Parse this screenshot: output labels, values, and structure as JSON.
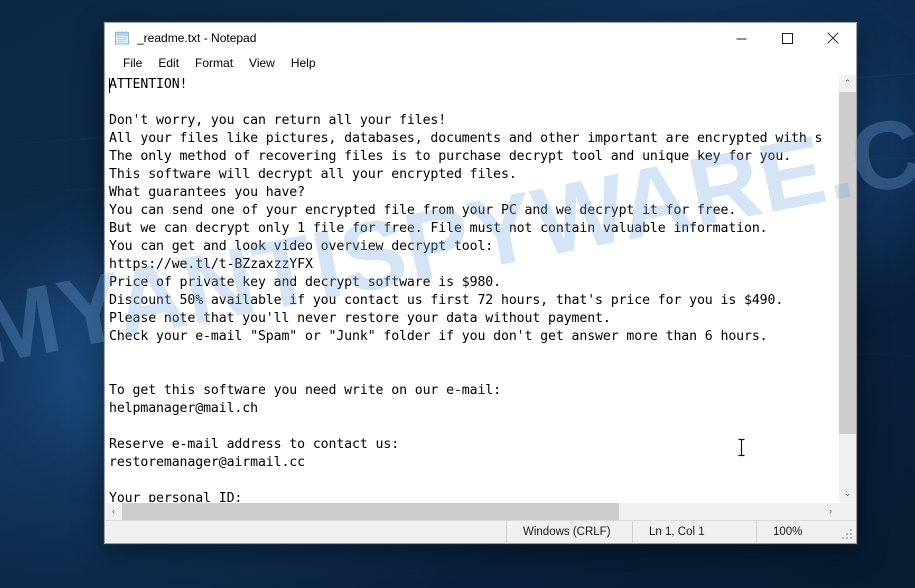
{
  "desktop": {
    "background_color": "#0a2340",
    "watermark_text": "MYANTISPYWARE.COM"
  },
  "window": {
    "title": "_readme.txt - Notepad",
    "icon": "notepad-icon",
    "controls": {
      "minimize_label": "Minimize",
      "maximize_label": "Maximize",
      "close_label": "Close"
    },
    "menu": [
      {
        "label": "File"
      },
      {
        "label": "Edit"
      },
      {
        "label": "Format"
      },
      {
        "label": "View"
      },
      {
        "label": "Help"
      }
    ]
  },
  "editor": {
    "content": "ATTENTION!\n\nDon't worry, you can return all your files!\nAll your files like pictures, databases, documents and other important are encrypted with s\nThe only method of recovering files is to purchase decrypt tool and unique key for you.\nThis software will decrypt all your encrypted files.\nWhat guarantees you have?\nYou can send one of your encrypted file from your PC and we decrypt it for free.\nBut we can decrypt only 1 file for free. File must not contain valuable information.\nYou can get and look video overview decrypt tool:\nhttps://we.tl/t-BZzaxzzYFX\nPrice of private key and decrypt software is $980.\nDiscount 50% available if you contact us first 72 hours, that's price for you is $490.\nPlease note that you'll never restore your data without payment.\nCheck your e-mail \"Spam\" or \"Junk\" folder if you don't get answer more than 6 hours.\n\n\nTo get this software you need write on our e-mail:\nhelpmanager@mail.ch\n\nReserve e-mail address to contact us:\nrestoremanager@airmail.cc\n\nYour personal ID:",
    "lines": [
      "ATTENTION!",
      "",
      "Don't worry, you can return all your files!",
      "All your files like pictures, databases, documents and other important are encrypted with s",
      "The only method of recovering files is to purchase decrypt tool and unique key for you.",
      "This software will decrypt all your encrypted files.",
      "What guarantees you have?",
      "You can send one of your encrypted file from your PC and we decrypt it for free.",
      "But we can decrypt only 1 file for free. File must not contain valuable information.",
      "You can get and look video overview decrypt tool:",
      "https://we.tl/t-BZzaxzzYFX",
      "Price of private key and decrypt software is $980.",
      "Discount 50% available if you contact us first 72 hours, that's price for you is $490.",
      "Please note that you'll never restore your data without payment.",
      "Check your e-mail \"Spam\" or \"Junk\" folder if you don't get answer more than 6 hours.",
      "",
      "",
      "To get this software you need write on our e-mail:",
      "helpmanager@mail.ch",
      "",
      "Reserve e-mail address to contact us:",
      "restoremanager@airmail.cc",
      "",
      "Your personal ID:"
    ],
    "ransom_details": {
      "video_url": "https://we.tl/t-BZzaxzzYFX",
      "price": "$980",
      "discount_price": "$490",
      "discount_percent": "50%",
      "discount_window": "72 hours",
      "response_time": "6 hours",
      "free_decrypt_files": "1 file",
      "primary_email": "helpmanager@mail.ch",
      "reserve_email": "restoremanager@airmail.cc"
    }
  },
  "scrollbars": {
    "vertical": {
      "up_arrow": "⌃",
      "down_arrow": "⌄",
      "thumb_percent": 87
    },
    "horizontal": {
      "left_arrow": "‹",
      "right_arrow": "›",
      "thumb_percent": 71
    }
  },
  "statusbar": {
    "line_ending": "Windows (CRLF)",
    "cursor_position": "Ln 1, Col 1",
    "zoom": "100%"
  }
}
